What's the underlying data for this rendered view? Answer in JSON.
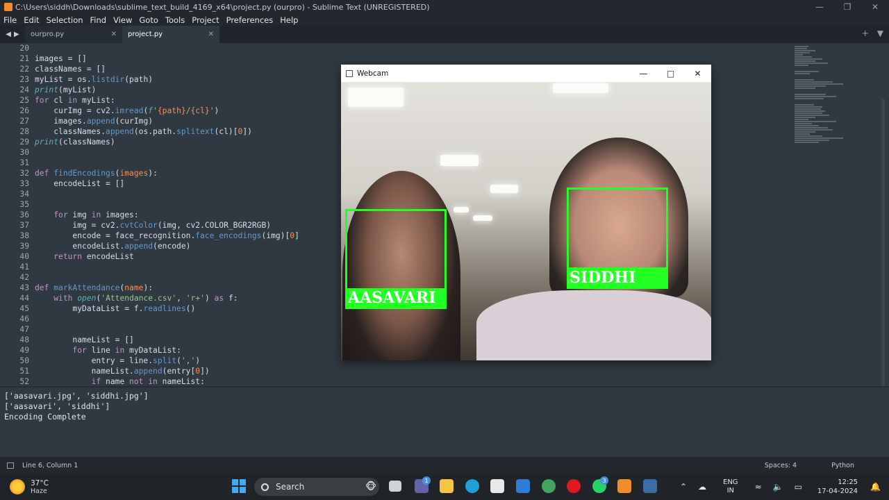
{
  "window": {
    "title": "C:\\Users\\siddh\\Downloads\\sublime_text_build_4169_x64\\project.py (ourpro) - Sublime Text (UNREGISTERED)"
  },
  "menu": [
    "File",
    "Edit",
    "Selection",
    "Find",
    "View",
    "Goto",
    "Tools",
    "Project",
    "Preferences",
    "Help"
  ],
  "tabs": [
    {
      "label": "ourpro.py",
      "active": false
    },
    {
      "label": "project.py",
      "active": true
    }
  ],
  "editor": {
    "line_numbers": [
      "20",
      "21",
      "22",
      "23",
      "24",
      "25",
      "26",
      "27",
      "28",
      "29",
      "30",
      "31",
      "32",
      "33",
      "34",
      "35",
      "36",
      "37",
      "38",
      "39",
      "40",
      "41",
      "42",
      "43",
      "44",
      "45",
      "46",
      "47",
      "48",
      "49",
      "50",
      "51",
      "52"
    ]
  },
  "output": {
    "lines": [
      "['aasavari.jpg', 'siddhi.jpg']",
      "['aasavari', 'siddhi']",
      "Encoding Complete"
    ]
  },
  "status": {
    "position": "Line 6, Column 1",
    "spaces": "Spaces: 4",
    "syntax": "Python"
  },
  "webcam": {
    "title": "Webcam",
    "faces": [
      {
        "name": "AASAVARI"
      },
      {
        "name": "SIDDHI"
      }
    ],
    "box_color": "#22ff22"
  },
  "taskbar": {
    "weather_temp": "37°C",
    "weather_desc": "Haze",
    "search_label": "Search",
    "badge_teams": "1",
    "badge_whatsapp": "3",
    "lang_top": "ENG",
    "lang_bottom": "IN",
    "time": "12:25",
    "date": "17-04-2024"
  }
}
